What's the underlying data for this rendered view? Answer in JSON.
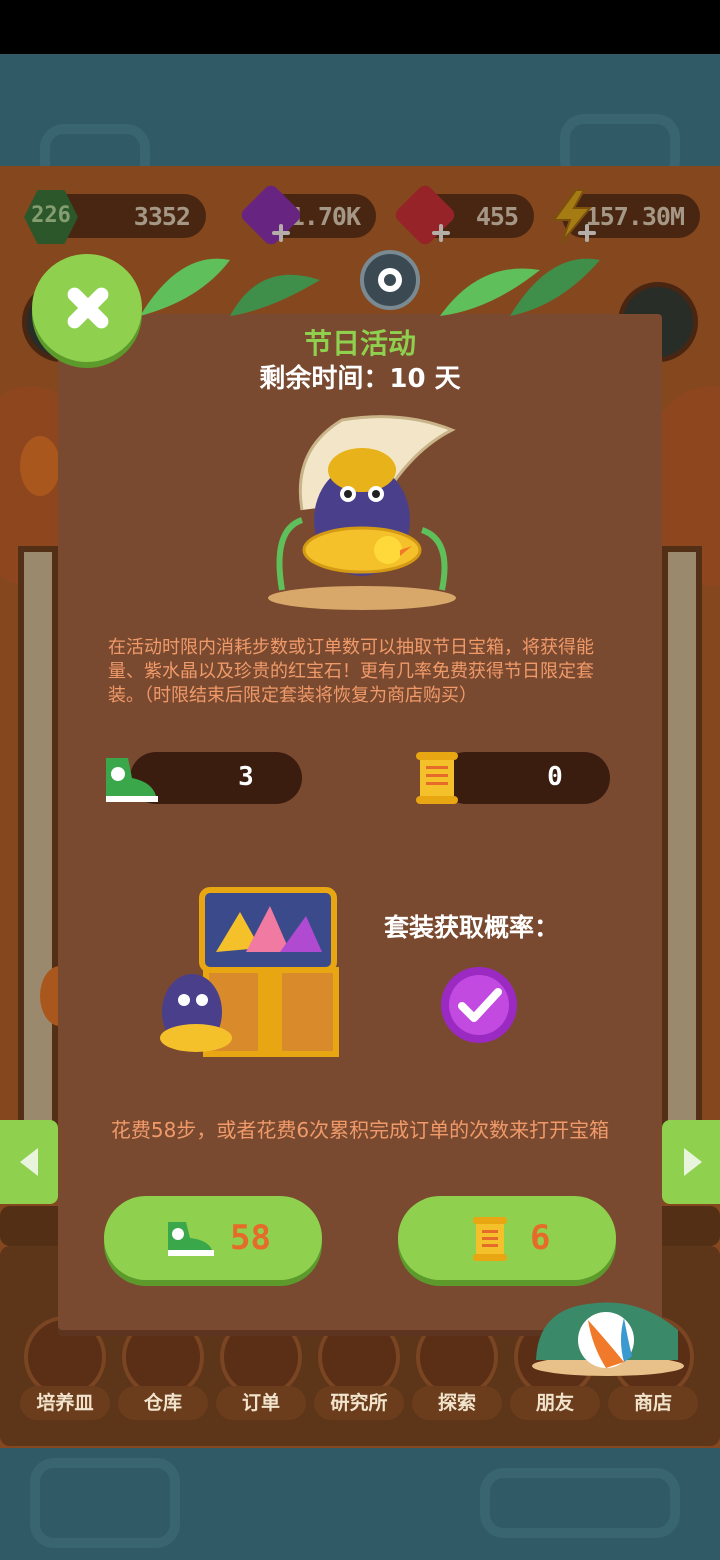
{
  "resources": {
    "level": "226",
    "coins": "3352",
    "crystals": "11.70K",
    "rubies": "455",
    "energy": "157.30M"
  },
  "event": {
    "title": "节日活动",
    "remaining": "剩余时间：10 天",
    "description": "在活动时限内消耗步数或订单数可以抽取节日宝箱，将获得能量、紫水晶以及珍贵的红宝石！更有几率免费获得节日限定套装。（时限结束后限定套装将恢复为商店购买）",
    "steps_count": "3",
    "orders_count": "0",
    "rate_label": "套装获取概率：",
    "hint": "花费58步，或者花费6次累积完成订单的次数来打开宝箱",
    "steps_cost": "58",
    "orders_cost": "6"
  },
  "nav": [
    {
      "label": "培养皿"
    },
    {
      "label": "仓库"
    },
    {
      "label": "订单"
    },
    {
      "label": "研究所"
    },
    {
      "label": "探索"
    },
    {
      "label": "朋友"
    },
    {
      "label": "商店"
    }
  ],
  "colors": {
    "accent_green": "#8fd14f",
    "panel_brown": "#7a4a30",
    "text_orange": "#f09a6a",
    "cost_orange": "#e66a2a"
  },
  "icons": [
    "close-icon",
    "shoe-icon",
    "scroll-icon",
    "chest-icon",
    "check-orb-icon",
    "arrow-left-icon",
    "arrow-right-icon"
  ]
}
